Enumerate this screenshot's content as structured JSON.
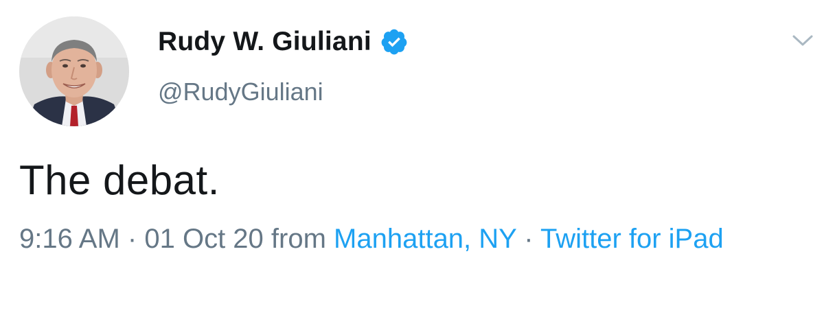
{
  "tweet": {
    "display_name": "Rudy W. Giuliani",
    "handle": "@RudyGiuliani",
    "text": "The debat.",
    "time": "9:16 AM",
    "separator": "·",
    "date": "01 Oct 20",
    "from_label": "from",
    "location": "Manhattan, NY",
    "source": "Twitter for iPad",
    "verified": true,
    "icons": {
      "verified": "verified-badge-icon",
      "menu": "chevron-down-icon"
    }
  },
  "colors": {
    "link": "#1da1f2",
    "secondary_text": "#657786",
    "primary_text": "#14171a",
    "verified_badge": "#1da1f2"
  }
}
